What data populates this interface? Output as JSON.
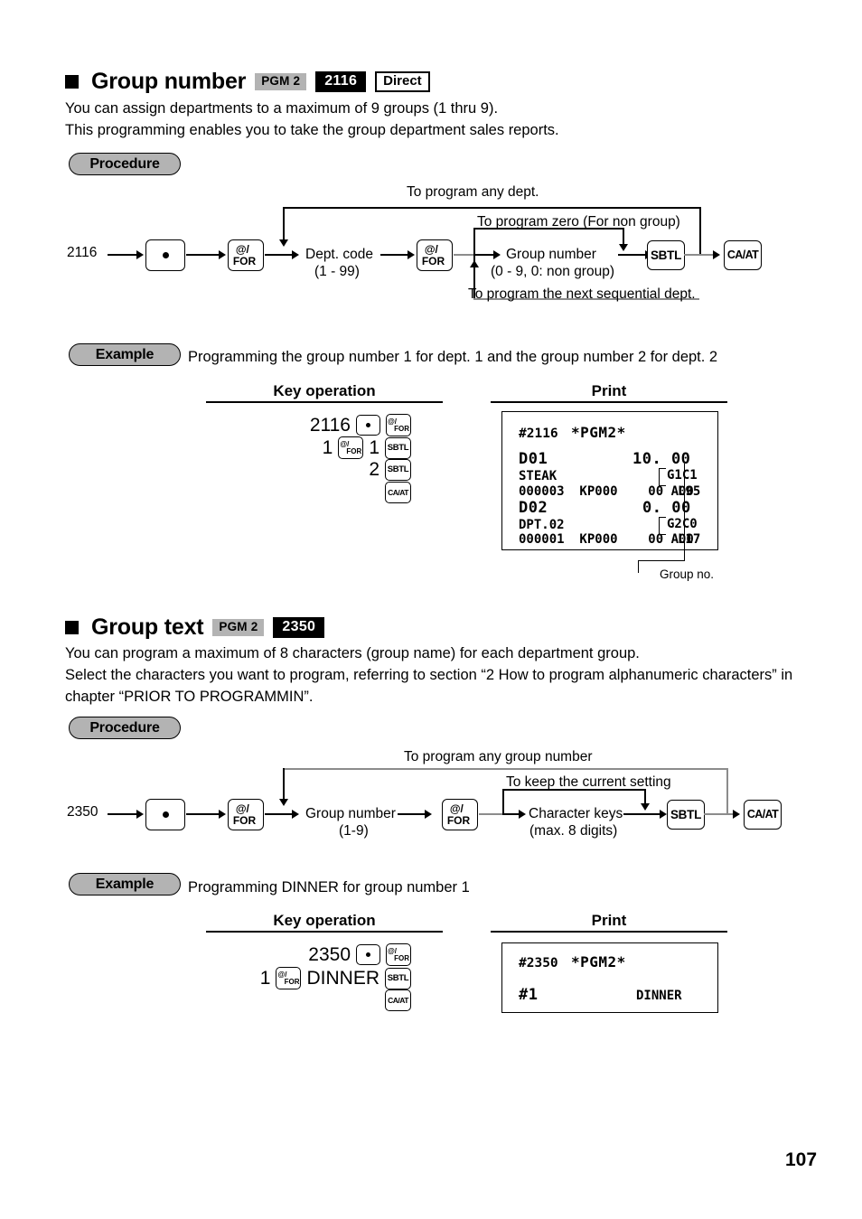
{
  "page": {
    "number": "107"
  },
  "sections": [
    {
      "id": "group-number",
      "title": "Group number",
      "badge_pgm": "PGM 2",
      "badge_code": "2116",
      "badge_direct": "Direct",
      "paragraphs": [
        "You can assign departments to a maximum of 9 groups (1 thru 9).",
        "This programming enables you to take the group department sales reports."
      ],
      "procedure_label": "Procedure",
      "procedure": {
        "start_number": "2116",
        "key_dot": "•",
        "key_for_at": "@/",
        "key_for_for": "FOR",
        "key_sbtl": "SBTL",
        "key_caat": "CA/AT",
        "node_dept_line1": "Dept. code",
        "node_dept_line2": "(1 - 99)",
        "node_group_line1": "Group number",
        "node_group_line2": "(0 - 9, 0: non group)",
        "loop_top": "To program any dept.",
        "loop_mid": "To program zero (For non group)",
        "loop_bottom": "To program the next sequential dept."
      },
      "example_label": "Example",
      "example_text": "Programming the group number 1 for dept. 1 and the group number 2 for dept. 2",
      "col_keyop_header": "Key operation",
      "col_print_header": "Print",
      "key_operation_rows": [
        {
          "items": [
            {
              "type": "num",
              "text": "2116"
            },
            {
              "type": "key",
              "key": "dot",
              "label": "•"
            },
            {
              "type": "key",
              "key": "for",
              "label": "@/FOR"
            }
          ]
        },
        {
          "items": [
            {
              "type": "num",
              "text": "1"
            },
            {
              "type": "key",
              "key": "for",
              "label": "@/FOR"
            },
            {
              "type": "num",
              "text": "1"
            },
            {
              "type": "key",
              "key": "sbtl",
              "label": "SBTL"
            }
          ]
        },
        {
          "items": [
            {
              "type": "num",
              "text": "2"
            },
            {
              "type": "key",
              "key": "sbtl",
              "label": "SBTL"
            }
          ]
        },
        {
          "items": [
            {
              "type": "key",
              "key": "caat",
              "label": "CA/AT"
            }
          ]
        }
      ],
      "receipt": {
        "header_code": "#2116",
        "header_mode": "*PGM2*",
        "lines": [
          {
            "left": "D01",
            "right": "10. 00",
            "style": "big"
          },
          {
            "left": "STEAK",
            "right": "G1C1",
            "style": "small"
          },
          {
            "left": "000003  KP000    00 A00",
            "right": "L95",
            "style": "small"
          },
          {
            "left": "D02",
            "right": "0. 00",
            "style": "big"
          },
          {
            "left": "DPT.02",
            "right": "G2C0",
            "style": "small"
          },
          {
            "left": "000001  KP000    00 A00",
            "right": "L17",
            "style": "small"
          }
        ]
      },
      "callout": "Group no."
    },
    {
      "id": "group-text",
      "title": "Group text",
      "badge_pgm": "PGM 2",
      "badge_code": "2350",
      "badge_direct": "",
      "paragraphs": [
        "You can program a maximum of 8 characters (group name) for each department group.",
        "Select the characters you want to program, referring to section “2  How to program alphanumeric characters” in",
        "chapter “PRIOR TO PROGRAMMIN”."
      ],
      "procedure_label": "Procedure",
      "procedure": {
        "start_number": "2350",
        "key_dot": "•",
        "key_for_at": "@/",
        "key_for_for": "FOR",
        "key_sbtl": "SBTL",
        "key_caat": "CA/AT",
        "node_group_line1": "Group number",
        "node_group_line2": "(1-9)",
        "node_char_line1": "Character keys",
        "node_char_line2": "(max. 8 digits)",
        "loop_top": "To program any group number",
        "loop_mid": "To keep the current setting"
      },
      "example_label": "Example",
      "example_text": "Programming DINNER for group number 1",
      "col_keyop_header": "Key operation",
      "col_print_header": "Print",
      "key_operation_rows": [
        {
          "items": [
            {
              "type": "num",
              "text": "2350"
            },
            {
              "type": "key",
              "key": "dot",
              "label": "•"
            },
            {
              "type": "key",
              "key": "for",
              "label": "@/FOR"
            }
          ]
        },
        {
          "items": [
            {
              "type": "num",
              "text": "1"
            },
            {
              "type": "key",
              "key": "for",
              "label": "@/FOR"
            },
            {
              "type": "num",
              "text": "DINNER"
            },
            {
              "type": "key",
              "key": "sbtl",
              "label": "SBTL"
            }
          ]
        },
        {
          "items": [
            {
              "type": "key",
              "key": "caat",
              "label": "CA/AT"
            }
          ]
        }
      ],
      "receipt": {
        "header_code": "#2350",
        "header_mode": "*PGM2*",
        "lines": [
          {
            "left": "#1",
            "right": "DINNER",
            "style": "mixed"
          }
        ]
      }
    }
  ]
}
